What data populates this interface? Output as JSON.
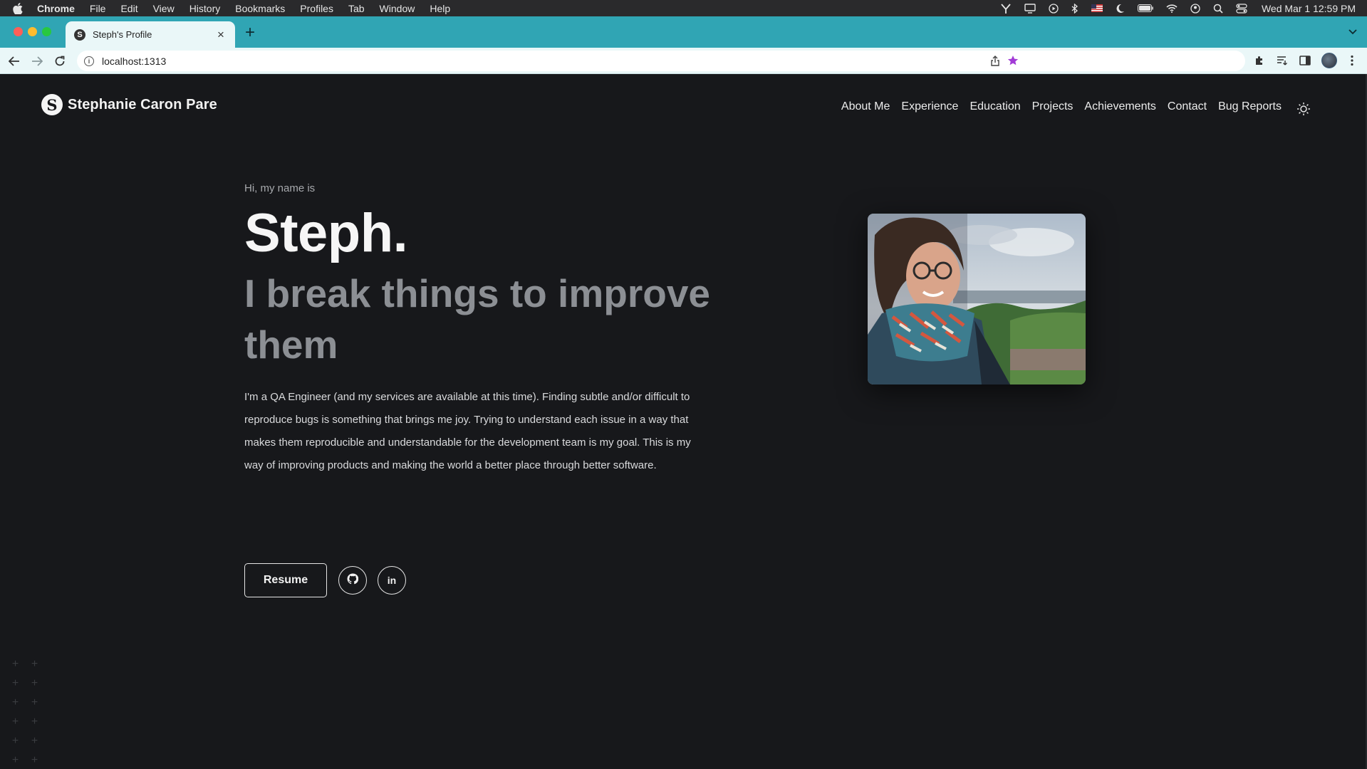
{
  "menubar": {
    "app": "Chrome",
    "items": [
      "File",
      "Edit",
      "View",
      "History",
      "Bookmarks",
      "Profiles",
      "Tab",
      "Window",
      "Help"
    ],
    "clock": "Wed Mar 1  12:59 PM"
  },
  "browser": {
    "tab_title": "Steph's Profile",
    "favicon_letter": "S",
    "url": "localhost:1313",
    "tab_color": "#30a5b4",
    "star_color": "#a23bd6"
  },
  "site": {
    "logo_letter": "S",
    "brand": "Stephanie Caron Pare",
    "nav": [
      "About Me",
      "Experience",
      "Education",
      "Projects",
      "Achievements",
      "Contact",
      "Bug Reports"
    ],
    "background": "#17181b"
  },
  "hero": {
    "greeting": "Hi, my name is",
    "name": "Steph.",
    "tagline": "I break things to improve them",
    "bio": "I'm a QA Engineer (and my services are available at this time). Finding subtle and/or difficult to reproduce bugs is something that brings me joy. Trying to understand each issue in a way that makes them reproducible and understandable for the development team is my goal. This is my way of improving products and making the world a better place through better software.",
    "resume_label": "Resume",
    "linkedin_label": "in"
  },
  "icons": {
    "github": "github-icon",
    "linkedin": "linkedin-icon",
    "theme": "sun-icon"
  }
}
